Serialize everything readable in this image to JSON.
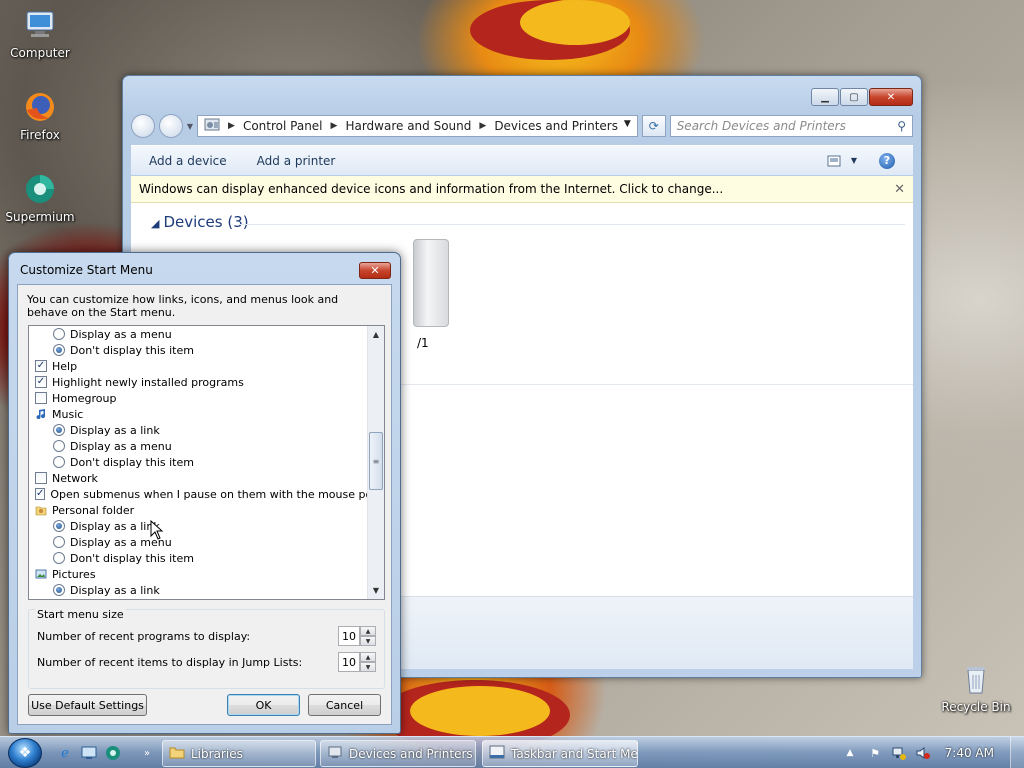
{
  "desktop": {
    "icons": [
      {
        "label": "Computer",
        "icon": "computer-icon"
      },
      {
        "label": "Firefox",
        "icon": "firefox-icon"
      },
      {
        "label": "Supermium",
        "icon": "supermium-icon"
      },
      {
        "label": "Recycle Bin",
        "icon": "recycle-bin-icon"
      }
    ]
  },
  "explorer": {
    "breadcrumb": [
      "Control Panel",
      "Hardware and Sound",
      "Devices and Printers"
    ],
    "search_placeholder": "Search Devices and Printers",
    "commands": [
      "Add a device",
      "Add a printer"
    ],
    "infobar_text": "Windows can display enhanced device icons and information from the Internet. Click to change...",
    "group_title": "Devices (3)",
    "device_label_partial": "/1"
  },
  "dialog": {
    "title": "Customize Start Menu",
    "intro": "You can customize how links, icons, and menus look and behave on the Start menu.",
    "list_items": [
      {
        "level": 2,
        "control": "radio",
        "checked": false,
        "label": "Display as a menu"
      },
      {
        "level": 2,
        "control": "radio",
        "checked": true,
        "label": "Don't display this item"
      },
      {
        "level": 1,
        "control": "checkbox",
        "checked": true,
        "label": "Help"
      },
      {
        "level": 1,
        "control": "checkbox",
        "checked": true,
        "label": "Highlight newly installed programs"
      },
      {
        "level": 1,
        "control": "checkbox",
        "checked": false,
        "label": "Homegroup"
      },
      {
        "level": 1,
        "control": "icon",
        "icon": "music-note-icon",
        "label": "Music"
      },
      {
        "level": 2,
        "control": "radio",
        "checked": true,
        "label": "Display as a link"
      },
      {
        "level": 2,
        "control": "radio",
        "checked": false,
        "label": "Display as a menu"
      },
      {
        "level": 2,
        "control": "radio",
        "checked": false,
        "label": "Don't display this item"
      },
      {
        "level": 1,
        "control": "checkbox",
        "checked": false,
        "label": "Network"
      },
      {
        "level": 1,
        "control": "checkbox",
        "checked": true,
        "label": "Open submenus when I pause on them with the mouse pointer"
      },
      {
        "level": 1,
        "control": "icon",
        "icon": "personal-folder-icon",
        "label": "Personal folder"
      },
      {
        "level": 2,
        "control": "radio",
        "checked": true,
        "label": "Display as a link"
      },
      {
        "level": 2,
        "control": "radio",
        "checked": false,
        "label": "Display as a menu"
      },
      {
        "level": 2,
        "control": "radio",
        "checked": false,
        "label": "Don't display this item"
      },
      {
        "level": 1,
        "control": "icon",
        "icon": "pictures-icon",
        "label": "Pictures"
      },
      {
        "level": 2,
        "control": "radio",
        "checked": true,
        "label": "Display as a link"
      }
    ],
    "size_legend": "Start menu size",
    "recent_programs_label": "Number of recent programs to display:",
    "recent_programs_value": "10",
    "jump_list_label": "Number of recent items to display in Jump Lists:",
    "jump_list_value": "10",
    "default_button": "Use Default Settings",
    "ok_button": "OK",
    "cancel_button": "Cancel"
  },
  "taskbar": {
    "buttons": [
      "Libraries",
      "Devices and Printers",
      "Taskbar and Start Me..."
    ],
    "clock": "7:40 AM"
  }
}
